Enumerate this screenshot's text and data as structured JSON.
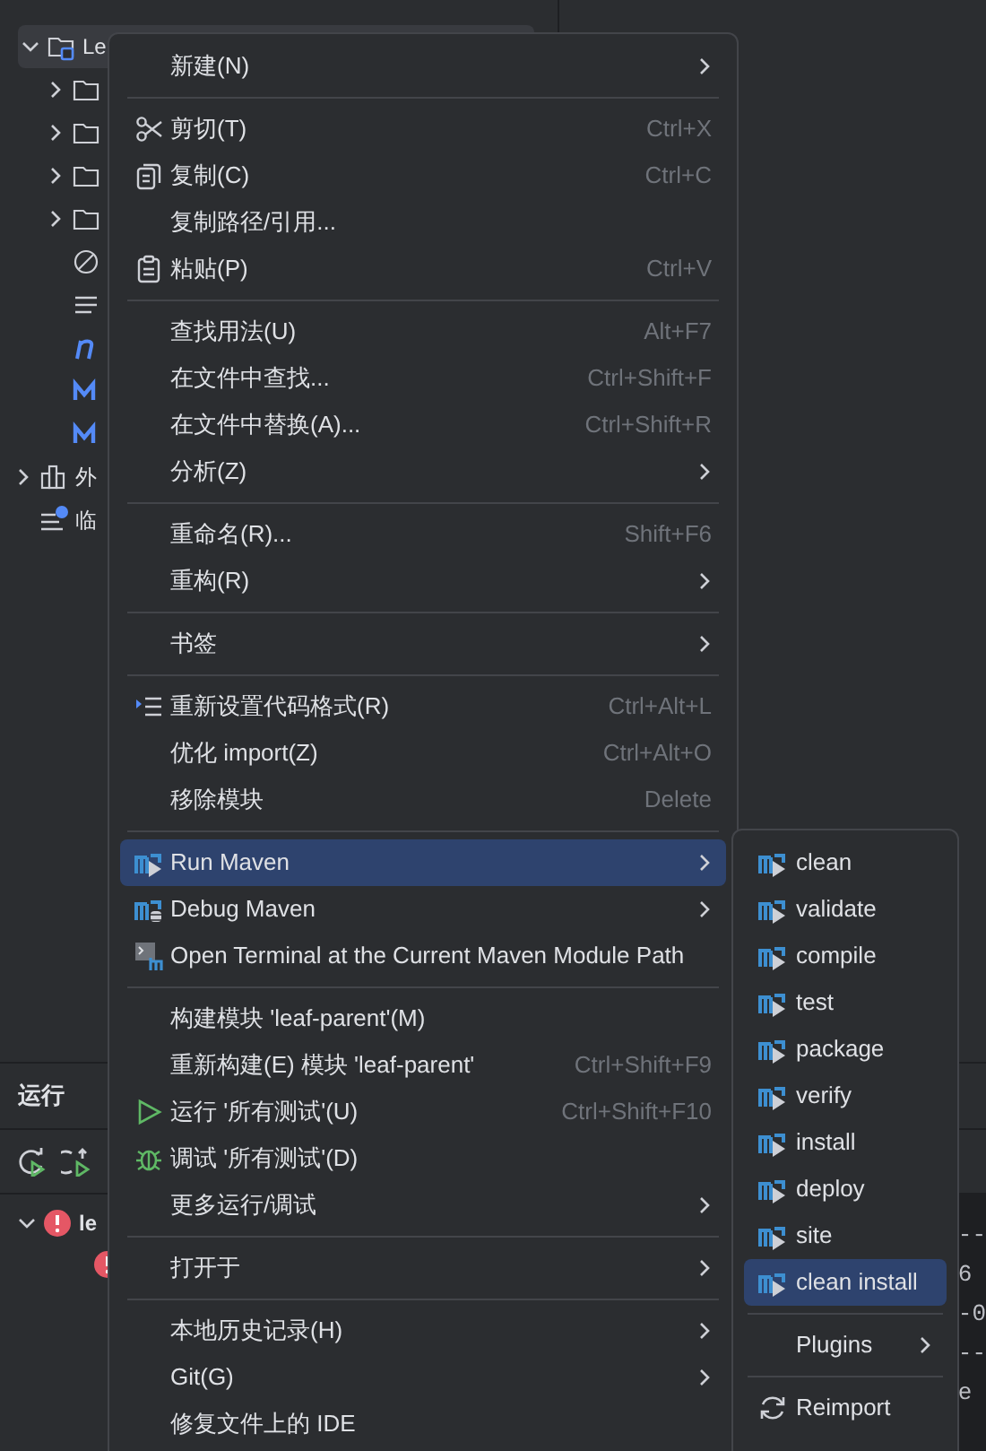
{
  "project_tree": [
    {
      "kind": "module",
      "label": "Le",
      "expanded": true,
      "selected": true,
      "children": [
        {
          "kind": "folder",
          "expanded": false,
          "selected": false
        },
        {
          "kind": "folder",
          "expanded": false,
          "selected": false
        },
        {
          "kind": "folder",
          "expanded": false,
          "selected": false
        },
        {
          "kind": "folder",
          "expanded": false,
          "selected": false
        },
        {
          "kind": "ignore",
          "selected": false
        },
        {
          "kind": "text",
          "selected": false
        },
        {
          "kind": "nfile",
          "selected": false
        },
        {
          "kind": "maven",
          "selected": false
        },
        {
          "kind": "maven",
          "selected": false
        }
      ]
    },
    {
      "kind": "libraries",
      "label": "外",
      "expanded": false,
      "selected": false
    },
    {
      "kind": "scratches",
      "label": "临",
      "selected": false
    }
  ],
  "run_panel": {
    "title": "运行",
    "tree": [
      {
        "kind": "error",
        "label": "le",
        "expanded": true,
        "children": [
          {
            "kind": "error"
          }
        ]
      }
    ],
    "console_lines": [
      "--",
      "6",
      "-0",
      "--",
      "e"
    ]
  },
  "context_menu": {
    "items": [
      {
        "kind": "plain",
        "label": "新建(N)",
        "submenu": true,
        "selected": false
      },
      {
        "kind": "separator"
      },
      {
        "kind": "cut",
        "label": "剪切(T)",
        "shortcut": "Ctrl+X",
        "submenu": false,
        "selected": false
      },
      {
        "kind": "copy",
        "label": "复制(C)",
        "shortcut": "Ctrl+C",
        "submenu": false,
        "selected": false
      },
      {
        "kind": "plain",
        "label": "复制路径/引用...",
        "submenu": false,
        "selected": false
      },
      {
        "kind": "paste",
        "label": "粘贴(P)",
        "shortcut": "Ctrl+V",
        "submenu": false,
        "selected": false
      },
      {
        "kind": "separator"
      },
      {
        "kind": "plain",
        "label": "查找用法(U)",
        "shortcut": "Alt+F7",
        "submenu": false,
        "selected": false
      },
      {
        "kind": "plain",
        "label": "在文件中查找...",
        "shortcut": "Ctrl+Shift+F",
        "submenu": false,
        "selected": false
      },
      {
        "kind": "plain",
        "label": "在文件中替换(A)...",
        "shortcut": "Ctrl+Shift+R",
        "submenu": false,
        "selected": false
      },
      {
        "kind": "plain",
        "label": "分析(Z)",
        "submenu": true,
        "selected": false
      },
      {
        "kind": "separator"
      },
      {
        "kind": "plain",
        "label": "重命名(R)...",
        "shortcut": "Shift+F6",
        "submenu": false,
        "selected": false
      },
      {
        "kind": "plain",
        "label": "重构(R)",
        "submenu": true,
        "selected": false
      },
      {
        "kind": "separator"
      },
      {
        "kind": "plain",
        "label": "书签",
        "submenu": true,
        "selected": false
      },
      {
        "kind": "separator"
      },
      {
        "kind": "reformat",
        "label": "重新设置代码格式(R)",
        "shortcut": "Ctrl+Alt+L",
        "submenu": false,
        "selected": false
      },
      {
        "kind": "plain",
        "label": "优化 import(Z)",
        "shortcut": "Ctrl+Alt+O",
        "submenu": false,
        "selected": false
      },
      {
        "kind": "plain",
        "label": "移除模块",
        "shortcut": "Delete",
        "submenu": false,
        "selected": false
      },
      {
        "kind": "separator"
      },
      {
        "kind": "mavenrun",
        "label": "Run Maven",
        "submenu": true,
        "selected": true
      },
      {
        "kind": "mavendebug",
        "label": "Debug Maven",
        "submenu": true,
        "selected": false
      },
      {
        "kind": "terminal",
        "label": "Open Terminal at the Current Maven Module Path",
        "submenu": false,
        "selected": false
      },
      {
        "kind": "separator"
      },
      {
        "kind": "plain",
        "label": "构建模块 'leaf-parent'(M)",
        "submenu": false,
        "selected": false
      },
      {
        "kind": "plain",
        "label": "重新构建(E) 模块 'leaf-parent'",
        "shortcut": "Ctrl+Shift+F9",
        "submenu": false,
        "selected": false
      },
      {
        "kind": "run",
        "label": "运行 '所有测试'(U)",
        "shortcut": "Ctrl+Shift+F10",
        "submenu": false,
        "selected": false
      },
      {
        "kind": "debug",
        "label": "调试 '所有测试'(D)",
        "submenu": false,
        "selected": false
      },
      {
        "kind": "plain",
        "label": "更多运行/调试",
        "submenu": true,
        "selected": false
      },
      {
        "kind": "separator"
      },
      {
        "kind": "plain",
        "label": "打开于",
        "submenu": true,
        "selected": false
      },
      {
        "kind": "separator"
      },
      {
        "kind": "plain",
        "label": "本地历史记录(H)",
        "submenu": true,
        "selected": false
      },
      {
        "kind": "plain",
        "label": "Git(G)",
        "submenu": true,
        "selected": false
      },
      {
        "kind": "plain",
        "label": "修复文件上的 IDE",
        "submenu": false,
        "selected": false
      }
    ]
  },
  "maven_submenu": {
    "items": [
      {
        "kind": "mavenrun",
        "label": "clean",
        "submenu": false,
        "selected": false
      },
      {
        "kind": "mavenrun",
        "label": "validate",
        "submenu": false,
        "selected": false
      },
      {
        "kind": "mavenrun",
        "label": "compile",
        "submenu": false,
        "selected": false
      },
      {
        "kind": "mavenrun",
        "label": "test",
        "submenu": false,
        "selected": false
      },
      {
        "kind": "mavenrun",
        "label": "package",
        "submenu": false,
        "selected": false
      },
      {
        "kind": "mavenrun",
        "label": "verify",
        "submenu": false,
        "selected": false
      },
      {
        "kind": "mavenrun",
        "label": "install",
        "submenu": false,
        "selected": false
      },
      {
        "kind": "mavenrun",
        "label": "deploy",
        "submenu": false,
        "selected": false
      },
      {
        "kind": "mavenrun",
        "label": "site",
        "submenu": false,
        "selected": false
      },
      {
        "kind": "mavenrun",
        "label": "clean install",
        "submenu": false,
        "selected": true
      },
      {
        "kind": "separator"
      },
      {
        "kind": "plain",
        "label": "Plugins",
        "submenu": true,
        "selected": false
      },
      {
        "kind": "separator"
      },
      {
        "kind": "reimport",
        "label": "Reimport",
        "submenu": false,
        "selected": false
      }
    ]
  }
}
